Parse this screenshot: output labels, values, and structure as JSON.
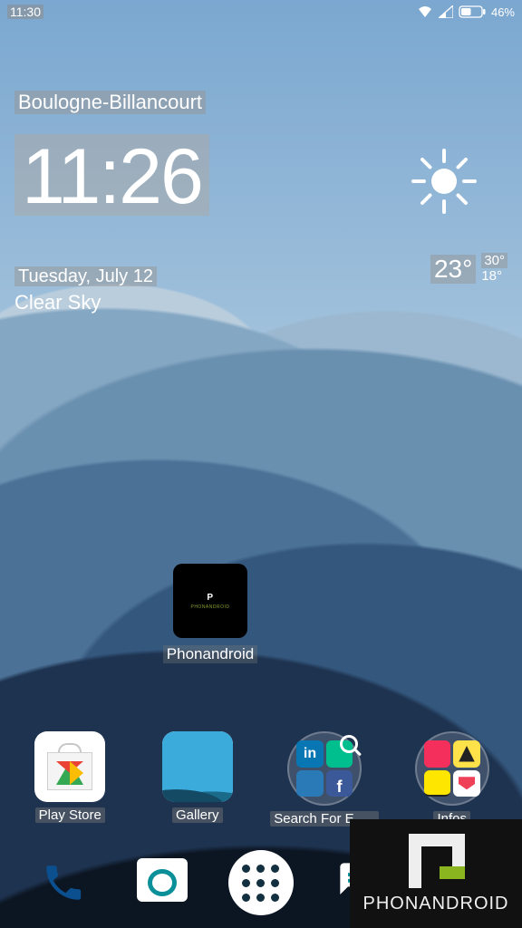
{
  "status": {
    "time": "11:30",
    "battery_pct": "46%"
  },
  "widget": {
    "location": "Boulogne-Billancourt",
    "clock": "11:26",
    "date": "Tuesday, July 12",
    "condition": "Clear Sky",
    "temp_current": "23°",
    "temp_high": "30°",
    "temp_low": "18°"
  },
  "mid_shortcut": {
    "label": "Phonandroid"
  },
  "apps": [
    {
      "label": "Play Store"
    },
    {
      "label": "Gallery"
    },
    {
      "label": "Search For Em…"
    },
    {
      "label": "Infos"
    }
  ],
  "watermark": {
    "text": "PHONANDROID"
  }
}
